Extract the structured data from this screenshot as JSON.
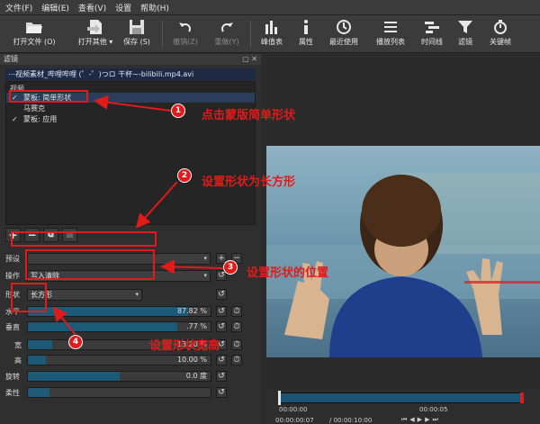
{
  "menu": [
    "文件(F)",
    "编辑(E)",
    "查看(V)",
    "设置",
    "帮助(H)"
  ],
  "toolbar": {
    "open_file": "打开文件 (O)",
    "open_other": "打开其他 ▾",
    "save": "保存 (S)",
    "undo": "撤销(Z)",
    "redo": "重做(Y)",
    "peak_meter": "峰值表",
    "properties": "属性",
    "recent": "最近使用",
    "playlist": "播放列表",
    "timeline": "时间线",
    "filters": "滤镜",
    "keyframes": "关键帧"
  },
  "filters_panel": {
    "title": "滤镜",
    "controls": "▢ ✕",
    "file_title": "⋯视频素材_哔哩哔哩 (゜-゜)つロ 干杯~-bilibili.mp4.avi",
    "section": "视频",
    "items": [
      {
        "check": "✓",
        "label": "蒙板: 简单形状"
      },
      {
        "check": "",
        "label": "马赛克"
      },
      {
        "check": "✓",
        "label": "蒙板: 应用"
      }
    ]
  },
  "list_tools": {
    "add": "+",
    "remove": "−",
    "copy": "⧉",
    "paste": "▦"
  },
  "params": {
    "preset_label": "预设",
    "preset_value": "",
    "operation_label": "操作",
    "operation_value": "写入清除",
    "shape_label": "形状",
    "shape_value": "长方形",
    "h_label": "水平",
    "h_value": "87.82 %",
    "h_fraction": 0.8782,
    "v_label": "垂直",
    "v_value": ".77 %",
    "v_fraction": 0.8177,
    "w_label": "宽",
    "w_value": "13.20 %",
    "w_fraction": 0.132,
    "ht_label": "高",
    "ht_value": "10.00 %",
    "ht_fraction": 0.1,
    "rot_label": "旋转",
    "rot_value": "0.0 度",
    "rot_fraction": 0.5,
    "soft_label": "柔性",
    "soft_value": "",
    "soft_fraction": 0.12
  },
  "annotations": {
    "b1": "1",
    "t1": "点击蒙版简单形状",
    "b2": "2",
    "t2": "设置形状为长方形",
    "b3": "3",
    "t3": "设置形状的位置",
    "b4": "4",
    "t4": "设置形状宽高"
  },
  "timeline": {
    "tick1": "00:00:00",
    "tick2": "00:00:05",
    "pos": "00:00:00:07",
    "dur": "/ 00:00:10:00"
  },
  "colors": {
    "accent_red": "#e11a1a",
    "slider_fill": "#1c5a78",
    "selection": "#2a3e5c"
  }
}
